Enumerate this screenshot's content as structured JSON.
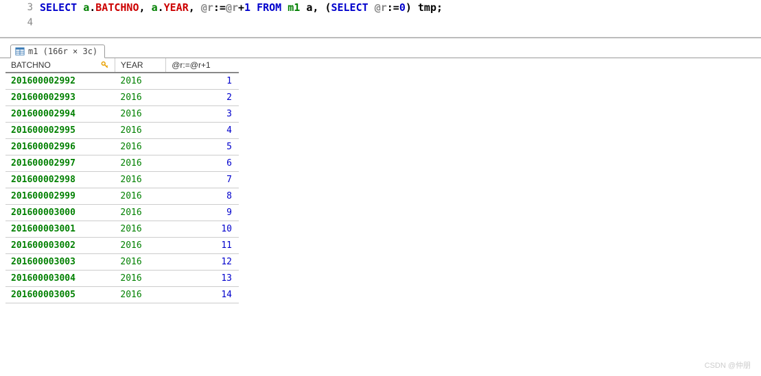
{
  "editor": {
    "lines": [
      {
        "num": "3",
        "tokens": [
          {
            "t": "kw",
            "v": "SELECT "
          },
          {
            "t": "id",
            "v": "a"
          },
          {
            "t": "dot",
            "v": "."
          },
          {
            "t": "col",
            "v": "BATCHNO"
          },
          {
            "t": "punct",
            "v": ", "
          },
          {
            "t": "id",
            "v": "a"
          },
          {
            "t": "dot",
            "v": "."
          },
          {
            "t": "col",
            "v": "YEAR"
          },
          {
            "t": "punct",
            "v": ", "
          },
          {
            "t": "var",
            "v": "@r"
          },
          {
            "t": "op",
            "v": ":="
          },
          {
            "t": "var",
            "v": "@r"
          },
          {
            "t": "op",
            "v": "+"
          },
          {
            "t": "num",
            "v": "1"
          },
          {
            "t": "kw",
            "v": " FROM "
          },
          {
            "t": "id",
            "v": "m1"
          },
          {
            "t": "punct",
            "v": " a, "
          },
          {
            "t": "punct",
            "v": "("
          },
          {
            "t": "kw",
            "v": "SELECT "
          },
          {
            "t": "var",
            "v": "@r"
          },
          {
            "t": "op",
            "v": ":="
          },
          {
            "t": "num",
            "v": "0"
          },
          {
            "t": "punct",
            "v": ") tmp;"
          }
        ]
      },
      {
        "num": "4",
        "tokens": []
      }
    ]
  },
  "results": {
    "tab_label": "m1 (166r × 3c)",
    "columns": {
      "batch": "BATCHNO",
      "year": "YEAR",
      "r": "@r:=@r+1"
    },
    "rows": [
      {
        "batch": "201600002992",
        "year": "2016",
        "r": "1"
      },
      {
        "batch": "201600002993",
        "year": "2016",
        "r": "2"
      },
      {
        "batch": "201600002994",
        "year": "2016",
        "r": "3"
      },
      {
        "batch": "201600002995",
        "year": "2016",
        "r": "4"
      },
      {
        "batch": "201600002996",
        "year": "2016",
        "r": "5"
      },
      {
        "batch": "201600002997",
        "year": "2016",
        "r": "6"
      },
      {
        "batch": "201600002998",
        "year": "2016",
        "r": "7"
      },
      {
        "batch": "201600002999",
        "year": "2016",
        "r": "8"
      },
      {
        "batch": "201600003000",
        "year": "2016",
        "r": "9"
      },
      {
        "batch": "201600003001",
        "year": "2016",
        "r": "10"
      },
      {
        "batch": "201600003002",
        "year": "2016",
        "r": "11"
      },
      {
        "batch": "201600003003",
        "year": "2016",
        "r": "12"
      },
      {
        "batch": "201600003004",
        "year": "2016",
        "r": "13"
      },
      {
        "batch": "201600003005",
        "year": "2016",
        "r": "14"
      }
    ]
  },
  "watermark": "CSDN @仲朋"
}
